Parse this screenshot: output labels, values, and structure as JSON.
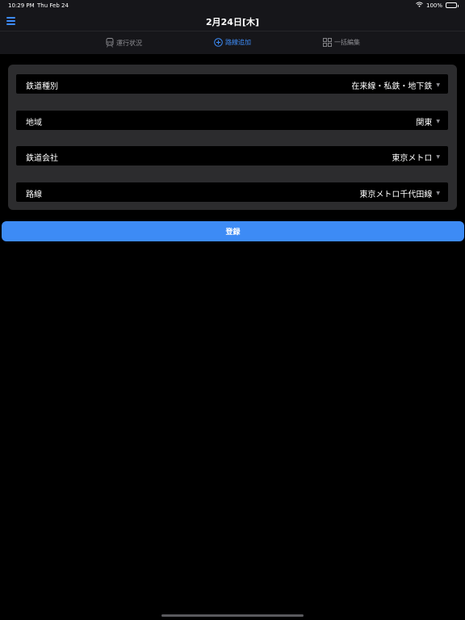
{
  "status_bar": {
    "time": "10:29 PM",
    "date": "Thu Feb 24",
    "battery": "100%",
    "wifi_icon": "wifi-icon",
    "battery_icon": "battery-icon"
  },
  "header": {
    "title": "2月24日[木]",
    "menu_icon": "hamburger-menu-icon"
  },
  "tabs": [
    {
      "label": "運行状況",
      "icon": "train-icon",
      "active": false
    },
    {
      "label": "路線追加",
      "icon": "plus-circle-icon",
      "active": true
    },
    {
      "label": "一括編集",
      "icon": "grid-icon",
      "active": false
    }
  ],
  "form": {
    "rows": [
      {
        "label": "鉄道種別",
        "value": "在来線・私鉄・地下鉄"
      },
      {
        "label": "地域",
        "value": "関東"
      },
      {
        "label": "鉄道会社",
        "value": "東京メトロ"
      },
      {
        "label": "路線",
        "value": "東京メトロ千代田線"
      }
    ],
    "caret_icon": "chevron-down-icon"
  },
  "register_button": {
    "label": "登録"
  },
  "colors": {
    "accent": "#3d8bf5",
    "background": "#000000",
    "card": "#2c2c2e",
    "bar": "#16161a",
    "inactive": "#8e8e93"
  }
}
